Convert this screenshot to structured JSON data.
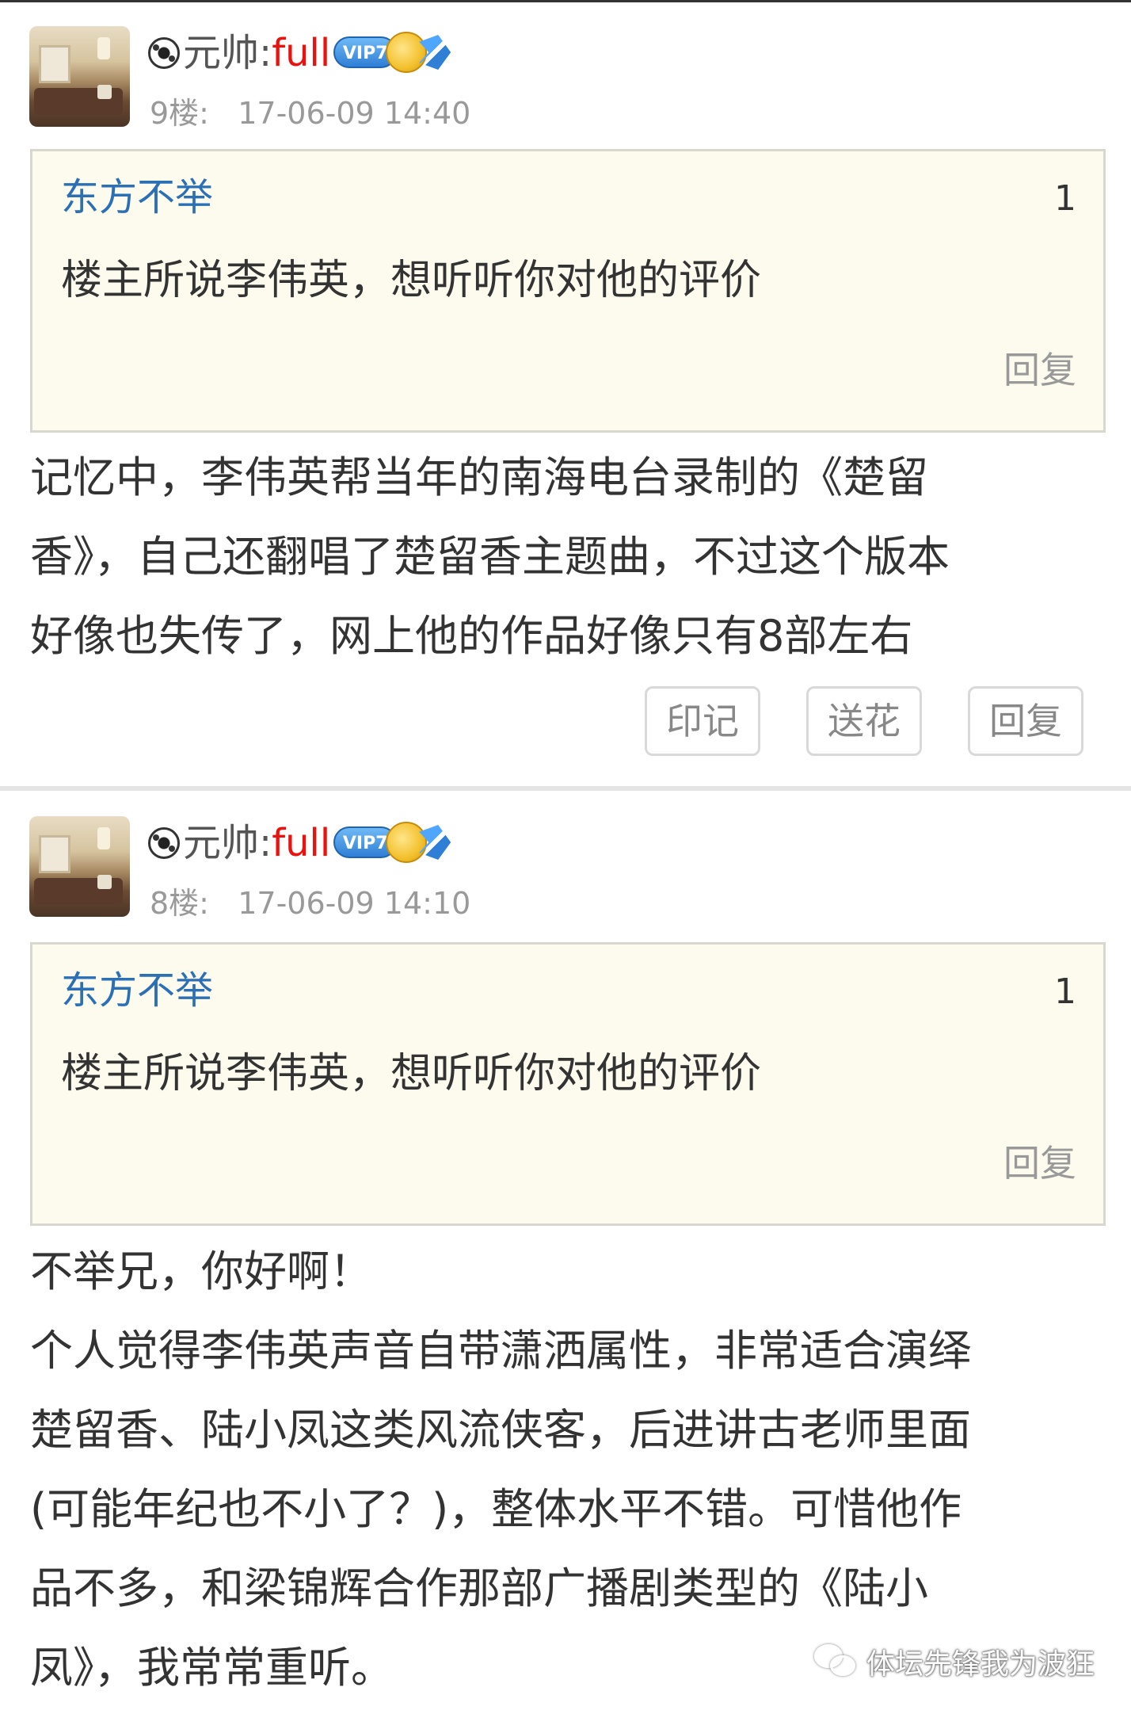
{
  "posts": [
    {
      "rank": "元帅:",
      "username": "full",
      "vip": "VIP7",
      "floor": "9楼:",
      "time": "17-06-09 14:40",
      "quote": {
        "author": "东方不举",
        "count": "1",
        "text": "楼主所说李伟英，想听听你对他的评价",
        "reply": "回复"
      },
      "body": [
        "记忆中，李伟英帮当年的南海电台录制的《楚留",
        "香》，自己还翻唱了楚留香主题曲，不过这个版本",
        "好像也失传了，网上他的作品好像只有8部左右"
      ],
      "actions": [
        "印记",
        "送花",
        "回复"
      ]
    },
    {
      "rank": "元帅:",
      "username": "full",
      "vip": "VIP7",
      "floor": "8楼:",
      "time": "17-06-09 14:10",
      "quote": {
        "author": "东方不举",
        "count": "1",
        "text": "楼主所说李伟英，想听听你对他的评价",
        "reply": "回复"
      },
      "body": [
        "不举兄，你好啊！",
        "个人觉得李伟英声音自带潇洒属性，非常适合演绎",
        "楚留香、陆小凤这类风流侠客，后进讲古老师里面",
        "(可能年纪也不小了？)，整体水平不错。可惜他作",
        "品不多，和梁锦辉合作那部广播剧类型的《陆小",
        "凤》，我常常重听。"
      ]
    }
  ],
  "watermark": "体坛先锋我为波狂",
  "colors": {
    "username": "#e8120e",
    "quote_author": "#2b6fb6",
    "quote_bg": "#fcfbee",
    "meta": "#999999"
  }
}
